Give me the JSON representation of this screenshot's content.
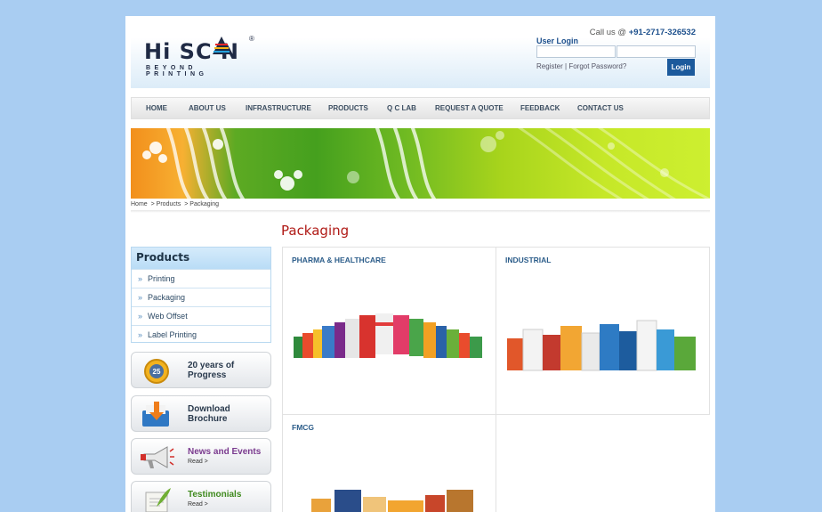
{
  "header": {
    "logo_text": "Hi SC N",
    "logo_tagline": "BEYOND PRINTING",
    "logo_reg": "®",
    "callus_label": "Call us @ ",
    "callus_number": "+91-2717-326532",
    "user_login_title": "User Login",
    "register_link": "Register",
    "link_separator": "|",
    "forgot_link": "Forgot Password?",
    "login_button": "Login"
  },
  "nav": {
    "items": [
      "HOME",
      "ABOUT US",
      "INFRASTRUCTURE",
      "PRODUCTS",
      "Q C LAB",
      "REQUEST A QUOTE",
      "FEEDBACK",
      "CONTACT US"
    ]
  },
  "breadcrumb": {
    "home": "Home",
    "products": "> Products",
    "current": "> Packaging"
  },
  "sidebar": {
    "title": "Products",
    "items": [
      "Printing",
      "Packaging",
      "Web Offset",
      "Label Printing"
    ],
    "promo": [
      {
        "line1": "20 years of",
        "line2": "Progress",
        "icon": "anniversary-25-icon"
      },
      {
        "line1": "Download",
        "line2": "Brochure",
        "icon": "download-folder-icon"
      },
      {
        "line1": "News and Events",
        "line2": "Read >",
        "icon": "megaphone-icon"
      },
      {
        "line1": "Testimonials",
        "line2": "Read >",
        "icon": "quill-paper-icon"
      }
    ]
  },
  "content": {
    "title": "Packaging",
    "categories": [
      "PHARMA & HEALTHCARE",
      "INDUSTRIAL",
      "FMCG"
    ]
  },
  "colors": {
    "accent_blue": "#1c5a9c",
    "title_red": "#b01a16",
    "page_bg": "#a9cdf2"
  }
}
